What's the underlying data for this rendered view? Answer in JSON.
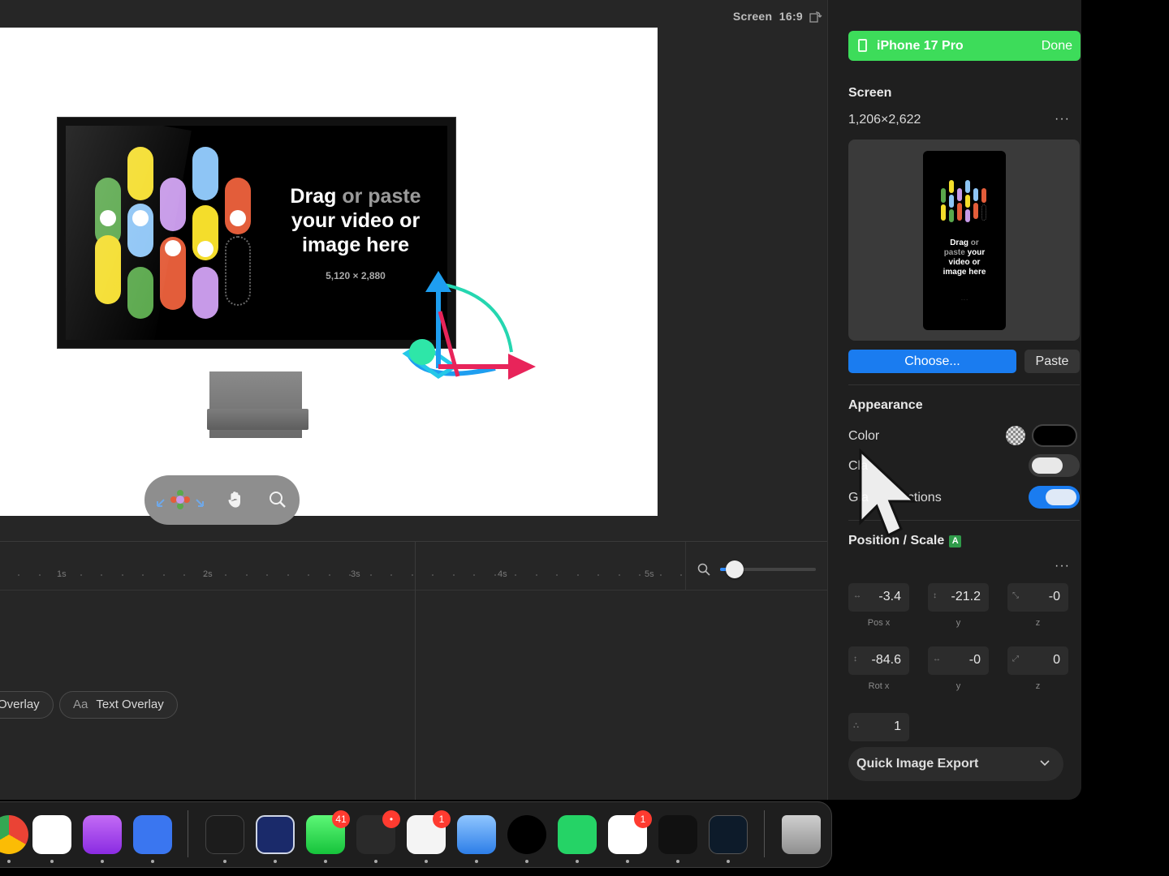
{
  "canvas_toolbar": {
    "screen_label": "Screen",
    "aspect_label": "16:9"
  },
  "placeholder": {
    "title_part1": "Drag",
    "title_part2": "or paste",
    "title_part3": "your video or image here",
    "size": "5,120 × 2,880"
  },
  "timeline": {
    "ticks": [
      "1s",
      "2s",
      "3s",
      "4s",
      "5s"
    ],
    "zoom_level": 0.15,
    "overlay_chips": [
      "Overlay",
      "Text Overlay"
    ],
    "text_chip_icon": "Aa"
  },
  "inspector": {
    "device_name": "iPhone 17 Pro",
    "done_label": "Done",
    "screen_section": "Screen",
    "screen_resolution": "1,206×2,622",
    "more_label": "···",
    "phone_preview": {
      "line1a": "Drag",
      "line1b": "or",
      "line2a": "paste",
      "line2b": "your",
      "line3": "video or",
      "line4": "image here"
    },
    "choose_label": "Choose...",
    "paste_label": "Paste",
    "appearance_section": "Appearance",
    "color_label": "Color",
    "clay_label_visible": "Cla",
    "glass_label_visible_start": "Gla",
    "glass_label_visible_end": "ctions",
    "clay_toggle": false,
    "glass_reflections_toggle": true,
    "position_section": "Position / Scale",
    "position_badge": "A",
    "pos_x": "-3.4",
    "pos_y": "-21.2",
    "pos_z": "-0",
    "pos_x_caption": "Pos x",
    "pos_y_caption": "y",
    "pos_z_caption": "z",
    "rot_x": "-84.6",
    "rot_y": "-0",
    "rot_z": "0",
    "rot_x_caption": "Rot x",
    "rot_y_caption": "y",
    "rot_z_caption": "z",
    "scale": "1",
    "export_label": "Quick Image Export"
  },
  "dock": {
    "apps": [
      {
        "name": "chrome-icon"
      },
      {
        "name": "slack-icon"
      },
      {
        "name": "podcasts-icon"
      },
      {
        "name": "signal-icon"
      },
      {
        "name": "rotato-icon"
      },
      {
        "name": "finder-icon"
      },
      {
        "name": "messages-icon",
        "badge": "41"
      },
      {
        "name": "linear-icon",
        "badge": "•"
      },
      {
        "name": "bear-icon",
        "badge": "1"
      },
      {
        "name": "cleaner-icon"
      },
      {
        "name": "spotify-icon"
      },
      {
        "name": "whatsapp-icon"
      },
      {
        "name": "chatgpt-icon",
        "badge": "1"
      },
      {
        "name": "arc-icon"
      },
      {
        "name": "screen-studio-icon"
      },
      {
        "name": "trash-icon"
      }
    ]
  },
  "colors": {
    "accent_blue": "#1a7cf0",
    "device_green": "#3ddc5a",
    "gizmo_x": "#e8245a",
    "gizmo_y": "#1e9ef0",
    "gizmo_z": "#25d6b0"
  }
}
